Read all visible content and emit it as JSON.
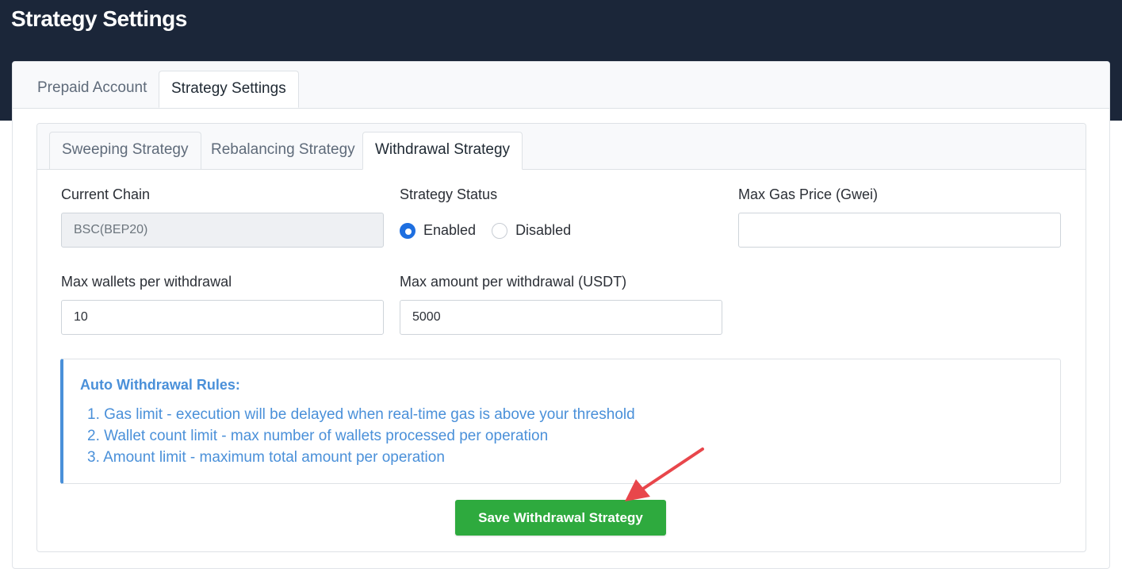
{
  "header": {
    "title": "Strategy Settings"
  },
  "main_tabs": [
    {
      "label": "Prepaid Account",
      "active": false
    },
    {
      "label": "Strategy Settings",
      "active": true
    }
  ],
  "sub_tabs": [
    {
      "label": "Sweeping Strategy",
      "active": false
    },
    {
      "label": "Rebalancing Strategy",
      "active": false
    },
    {
      "label": "Withdrawal Strategy",
      "active": true
    }
  ],
  "form": {
    "current_chain": {
      "label": "Current Chain",
      "value": "BSC(BEP20)"
    },
    "strategy_status": {
      "label": "Strategy Status",
      "options": [
        {
          "label": "Enabled",
          "checked": true
        },
        {
          "label": "Disabled",
          "checked": false
        }
      ]
    },
    "max_gas_price": {
      "label": "Max Gas Price (Gwei)",
      "value": ""
    },
    "max_wallets": {
      "label": "Max wallets per withdrawal",
      "value": "10"
    },
    "max_amount": {
      "label": "Max amount per withdrawal (USDT)",
      "value": "5000"
    }
  },
  "rules": {
    "title": "Auto Withdrawal Rules:",
    "items": [
      "1. Gas limit - execution will be delayed when real-time gas is above your threshold",
      "2. Wallet count limit - max number of wallets processed per operation",
      "3. Amount limit - maximum total amount per operation"
    ]
  },
  "actions": {
    "save_label": "Save Withdrawal Strategy"
  },
  "colors": {
    "header_bg": "#1b2639",
    "accent_blue": "#4a90d9",
    "radio_blue": "#1e6fe0",
    "save_green": "#2eaa3e",
    "arrow_red": "#e8464b"
  }
}
